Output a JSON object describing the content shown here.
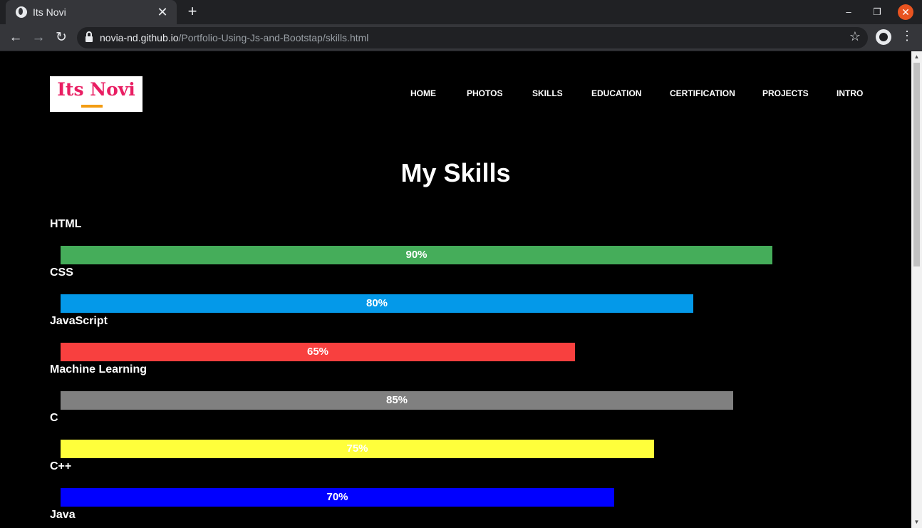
{
  "browser": {
    "tab_title": "Its Novi",
    "url_host": "novia-nd.github.io",
    "url_path": "/Portfolio-Using-Js-and-Bootstap/skills.html"
  },
  "site": {
    "logo_text": "Its Novi",
    "nav": [
      "HOME",
      "PHOTOS",
      "SKILLS",
      "EDUCATION",
      "CERTIFICATION",
      "PROJECTS",
      "INTRO"
    ]
  },
  "main": {
    "heading": "My Skills",
    "skills": [
      {
        "name": "HTML",
        "percent_label": "90%",
        "fraction": 0.9,
        "color": "#45ad5a"
      },
      {
        "name": "CSS",
        "percent_label": "80%",
        "fraction": 0.8,
        "color": "#0499e9"
      },
      {
        "name": "JavaScript",
        "percent_label": "65%",
        "fraction": 0.65,
        "color": "#f8403f"
      },
      {
        "name": "Machine Learning",
        "percent_label": "85%",
        "fraction": 0.85,
        "color": "#808080"
      },
      {
        "name": "C",
        "percent_label": "75%",
        "fraction": 0.75,
        "color": "#ffff3b"
      },
      {
        "name": "C++",
        "percent_label": "70%",
        "fraction": 0.7,
        "color": "#0000ff"
      },
      {
        "name": "Java",
        "percent_label": "",
        "fraction": null,
        "color": ""
      }
    ]
  },
  "icons": {
    "tab": "globe-icon",
    "close": "close-icon",
    "new_tab": "plus-icon",
    "back": "arrow-left-icon",
    "forward": "arrow-right-icon",
    "reload": "reload-icon",
    "lock": "lock-icon",
    "bookmark": "star-icon",
    "profile": "profile-icon",
    "menu": "kebab-menu-icon"
  }
}
